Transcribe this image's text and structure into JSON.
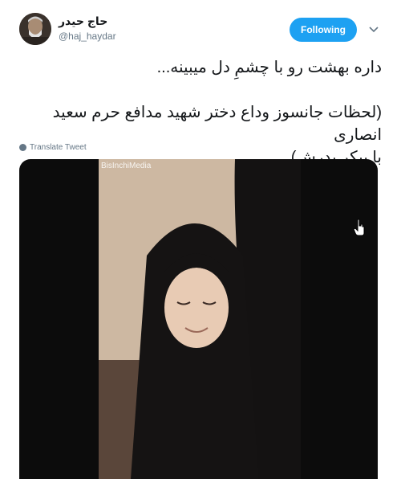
{
  "tweet": {
    "display_name": "حاج حیدر",
    "handle": "@haj_haydar",
    "follow_label": "Following",
    "text_lines": [
      "داره بهشت رو با چشمِ دل میبینه...",
      "",
      "(لحظات جانسوز وداع دختر شهید مدافع حرم سعید انصاری",
      "با پیکر پدرش)"
    ],
    "translate_label": "Translate Tweet"
  },
  "media": {
    "watermark": "BisInchiMedia"
  },
  "colors": {
    "accent": "#1da1f2",
    "text": "#14171a",
    "muted": "#657786",
    "video_bg": "#0c0c0c"
  },
  "icons": {
    "caret": "chevron-down-icon",
    "translate": "globe-icon",
    "cursor": "hand-pointer-icon"
  }
}
